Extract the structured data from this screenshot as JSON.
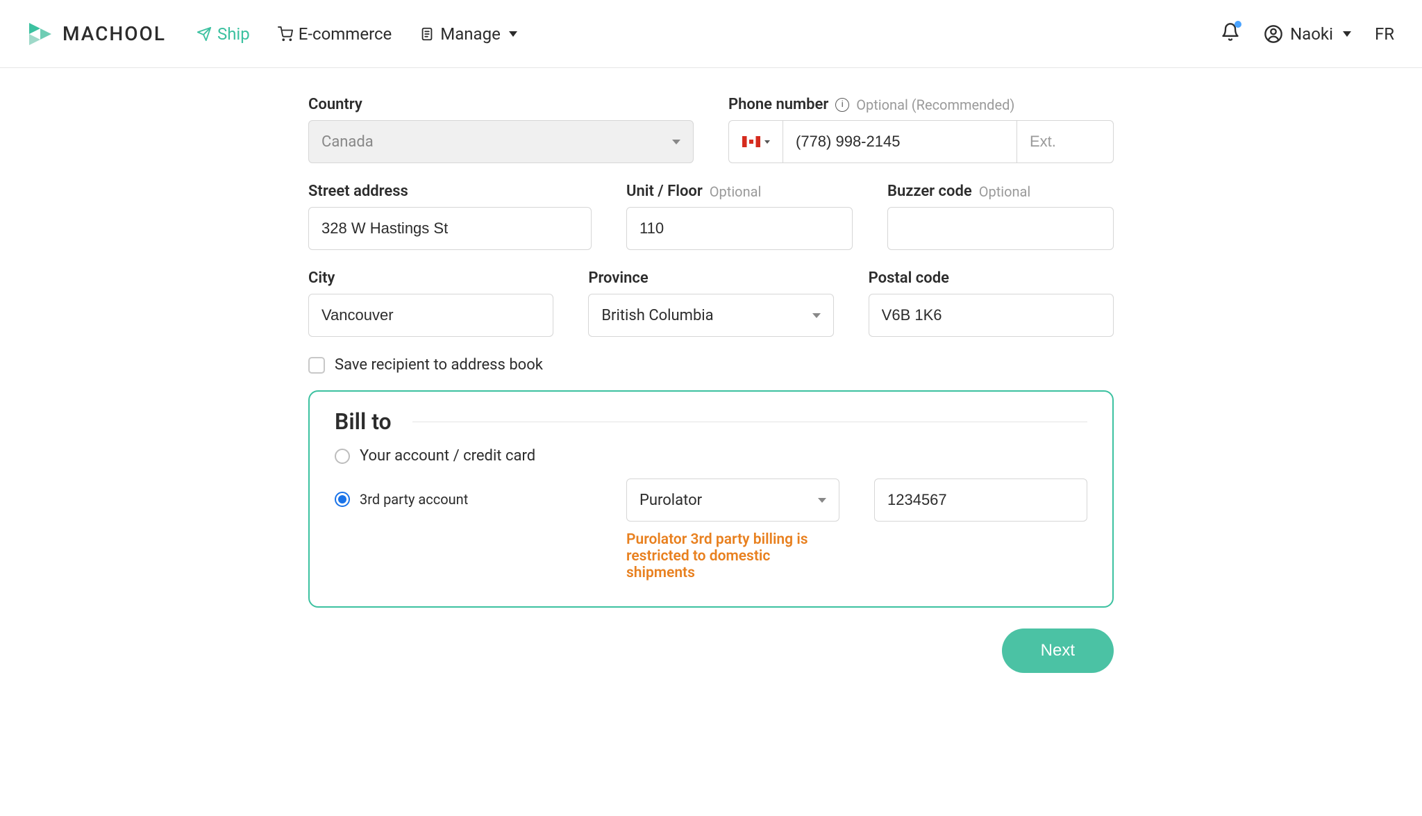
{
  "header": {
    "logo_text": "MACHOOL",
    "nav": {
      "ship": "Ship",
      "ecommerce": "E-commerce",
      "manage": "Manage"
    },
    "user_name": "Naoki",
    "lang": "FR"
  },
  "form": {
    "country": {
      "label": "Country",
      "value": "Canada"
    },
    "phone": {
      "label": "Phone number",
      "hint": "Optional (Recommended)",
      "value": "(778) 998-2145",
      "ext_placeholder": "Ext."
    },
    "street": {
      "label": "Street address",
      "value": "328 W Hastings St"
    },
    "unit": {
      "label": "Unit / Floor",
      "hint": "Optional",
      "value": "110"
    },
    "buzzer": {
      "label": "Buzzer code",
      "hint": "Optional",
      "value": ""
    },
    "city": {
      "label": "City",
      "value": "Vancouver"
    },
    "province": {
      "label": "Province",
      "value": "British Columbia"
    },
    "postal": {
      "label": "Postal code",
      "value": "V6B 1K6"
    },
    "save_recipient": "Save recipient to address book"
  },
  "billto": {
    "title": "Bill to",
    "option_your_account": "Your account / credit card",
    "option_third_party": "3rd party account",
    "carrier": "Purolator",
    "account_number": "1234567",
    "warning": "Purolator 3rd party billing is restricted to domestic shipments"
  },
  "footer": {
    "next": "Next"
  }
}
